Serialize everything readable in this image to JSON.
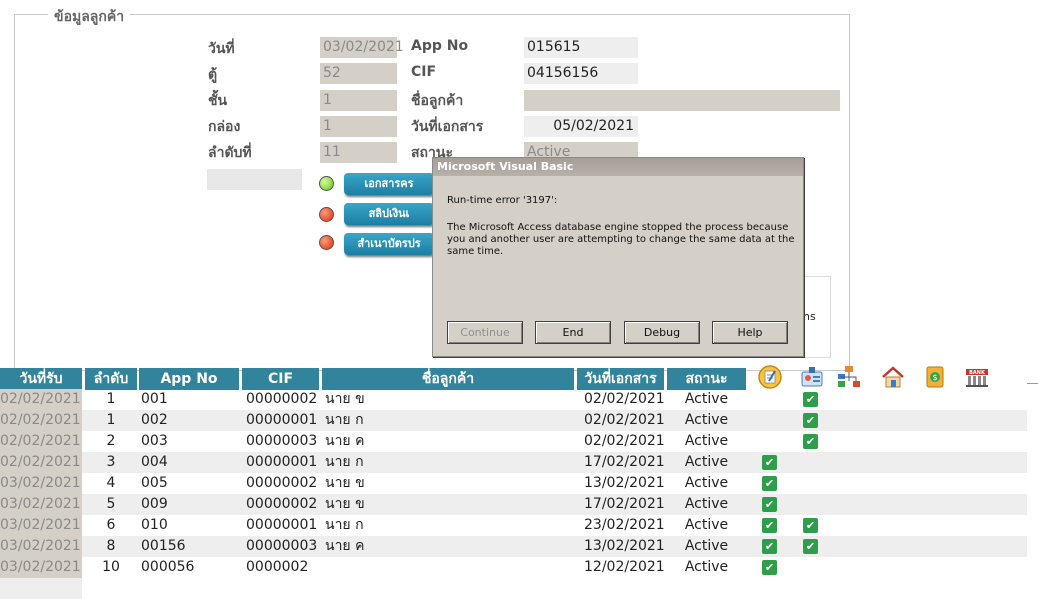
{
  "section": {
    "title": "ข้อมูลลูกค้า"
  },
  "form": {
    "date_label": "วันที่",
    "date_value": "03/02/2021",
    "cabinet_label": "ตู้",
    "cabinet_value": "52",
    "shelf_label": "ชั้น",
    "shelf_value": "1",
    "box_label": "กล่อง",
    "box_value": "1",
    "seq_label": "ลำดับที่",
    "seq_value": "11",
    "appno_label": "App No",
    "appno_value": "015615",
    "cif_label": "CIF",
    "cif_value": "04156156",
    "name_label": "ชื่อลูกค้า",
    "name_value": "",
    "docdate_label": "วันที่เอกสาร",
    "docdate_value": "05/02/2021",
    "status_label": "สถานะ",
    "status_value": "Active"
  },
  "doc_buttons": [
    {
      "label": "เอกสารคร",
      "status": "green"
    },
    {
      "label": "สลิปเงินเ",
      "status": "red"
    },
    {
      "label": "สำเนาบัตรปร",
      "status": "red"
    }
  ],
  "behind_text": "ns",
  "dialog": {
    "title": "Microsoft Visual Basic",
    "error": "Run-time error '3197':",
    "message_lines": [
      "The Microsoft Access database engine stopped the process because",
      "you and another user are attempting to change the same data at the",
      "same time."
    ],
    "buttons": {
      "continue": "Continue",
      "end": "End",
      "debug": "Debug",
      "help": "Help"
    }
  },
  "table": {
    "headers": [
      "วันที่รับ",
      "ลำดับ",
      "App No",
      "CIF",
      "ชื่อลูกค้า",
      "วันที่เอกสาร",
      "สถานะ"
    ],
    "icons": [
      "memo-icon",
      "id-card-icon",
      "org-chart-icon",
      "house-icon",
      "money-icon",
      "bank-icon"
    ],
    "rows": [
      {
        "recv": "02/02/2021",
        "seq": "1",
        "app": "001",
        "cif": "00000002",
        "name": "นาย ข",
        "doc": "02/02/2021",
        "status": "Active",
        "c1": false,
        "c2": true
      },
      {
        "recv": "02/02/2021",
        "seq": "1",
        "app": "002",
        "cif": "00000001",
        "name": "นาย ก",
        "doc": "02/02/2021",
        "status": "Active",
        "c1": false,
        "c2": true
      },
      {
        "recv": "02/02/2021",
        "seq": "2",
        "app": "003",
        "cif": "00000003",
        "name": "นาย ค",
        "doc": "02/02/2021",
        "status": "Active",
        "c1": false,
        "c2": true
      },
      {
        "recv": "02/02/2021",
        "seq": "3",
        "app": "004",
        "cif": "00000001",
        "name": "นาย ก",
        "doc": "17/02/2021",
        "status": "Active",
        "c1": true,
        "c2": false
      },
      {
        "recv": "03/02/2021",
        "seq": "4",
        "app": "005",
        "cif": "00000002",
        "name": "นาย ข",
        "doc": "13/02/2021",
        "status": "Active",
        "c1": true,
        "c2": false
      },
      {
        "recv": "03/02/2021",
        "seq": "5",
        "app": "009",
        "cif": "00000002",
        "name": "นาย ข",
        "doc": "17/02/2021",
        "status": "Active",
        "c1": true,
        "c2": false
      },
      {
        "recv": "03/02/2021",
        "seq": "6",
        "app": "010",
        "cif": "00000001",
        "name": "นาย ก",
        "doc": "23/02/2021",
        "status": "Active",
        "c1": true,
        "c2": true
      },
      {
        "recv": "03/02/2021",
        "seq": "8",
        "app": "00156",
        "cif": "00000003",
        "name": "นาย ค",
        "doc": "13/02/2021",
        "status": "Active",
        "c1": true,
        "c2": true
      },
      {
        "recv": "03/02/2021",
        "seq": "10",
        "app": "000056",
        "cif": "0000002",
        "name": "",
        "doc": "12/02/2021",
        "status": "Active",
        "c1": true,
        "c2": false
      }
    ]
  }
}
